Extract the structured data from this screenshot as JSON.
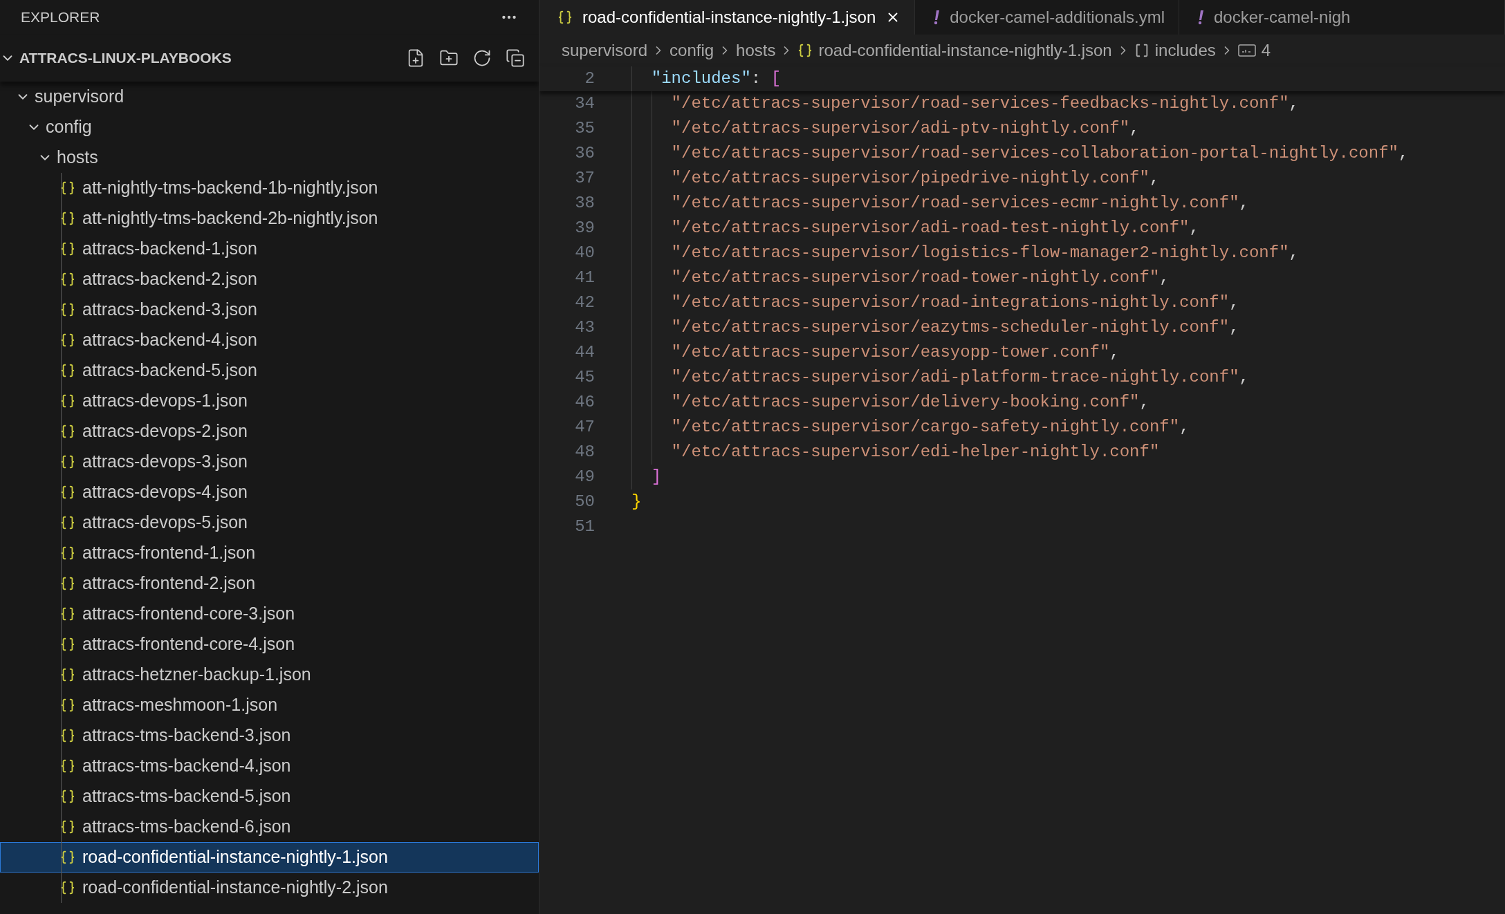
{
  "sidebar": {
    "title": "EXPLORER",
    "workspace": {
      "name": "ATTRACS-LINUX-PLAYBOOKS",
      "expanded": true
    },
    "tree": [
      {
        "name": "supervisord",
        "kind": "folder",
        "expanded": true,
        "children": [
          {
            "name": "config",
            "kind": "folder",
            "expanded": true,
            "children": [
              {
                "name": "hosts",
                "kind": "folder",
                "expanded": true,
                "children": [
                  {
                    "name": "att-nightly-tms-backend-1b-nightly.json",
                    "kind": "file",
                    "selected": false
                  },
                  {
                    "name": "att-nightly-tms-backend-2b-nightly.json",
                    "kind": "file",
                    "selected": false
                  },
                  {
                    "name": "attracs-backend-1.json",
                    "kind": "file",
                    "selected": false
                  },
                  {
                    "name": "attracs-backend-2.json",
                    "kind": "file",
                    "selected": false
                  },
                  {
                    "name": "attracs-backend-3.json",
                    "kind": "file",
                    "selected": false
                  },
                  {
                    "name": "attracs-backend-4.json",
                    "kind": "file",
                    "selected": false
                  },
                  {
                    "name": "attracs-backend-5.json",
                    "kind": "file",
                    "selected": false
                  },
                  {
                    "name": "attracs-devops-1.json",
                    "kind": "file",
                    "selected": false
                  },
                  {
                    "name": "attracs-devops-2.json",
                    "kind": "file",
                    "selected": false
                  },
                  {
                    "name": "attracs-devops-3.json",
                    "kind": "file",
                    "selected": false
                  },
                  {
                    "name": "attracs-devops-4.json",
                    "kind": "file",
                    "selected": false
                  },
                  {
                    "name": "attracs-devops-5.json",
                    "kind": "file",
                    "selected": false
                  },
                  {
                    "name": "attracs-frontend-1.json",
                    "kind": "file",
                    "selected": false
                  },
                  {
                    "name": "attracs-frontend-2.json",
                    "kind": "file",
                    "selected": false
                  },
                  {
                    "name": "attracs-frontend-core-3.json",
                    "kind": "file",
                    "selected": false
                  },
                  {
                    "name": "attracs-frontend-core-4.json",
                    "kind": "file",
                    "selected": false
                  },
                  {
                    "name": "attracs-hetzner-backup-1.json",
                    "kind": "file",
                    "selected": false
                  },
                  {
                    "name": "attracs-meshmoon-1.json",
                    "kind": "file",
                    "selected": false
                  },
                  {
                    "name": "attracs-tms-backend-3.json",
                    "kind": "file",
                    "selected": false
                  },
                  {
                    "name": "attracs-tms-backend-4.json",
                    "kind": "file",
                    "selected": false
                  },
                  {
                    "name": "attracs-tms-backend-5.json",
                    "kind": "file",
                    "selected": false
                  },
                  {
                    "name": "attracs-tms-backend-6.json",
                    "kind": "file",
                    "selected": false
                  },
                  {
                    "name": "road-confidential-instance-nightly-1.json",
                    "kind": "file",
                    "selected": true
                  },
                  {
                    "name": "road-confidential-instance-nightly-2.json",
                    "kind": "file",
                    "selected": false
                  }
                ]
              }
            ]
          }
        ]
      }
    ]
  },
  "tabs": [
    {
      "label": "road-confidential-instance-nightly-1.json",
      "kind": "json",
      "selected": true
    },
    {
      "label": "docker-camel-additionals.yml",
      "kind": "yaml",
      "selected": false
    },
    {
      "label": "docker-camel-nigh",
      "kind": "yaml",
      "selected": false
    }
  ],
  "breadcrumbs": [
    {
      "label": "supervisord",
      "kind": "folder"
    },
    {
      "label": "config",
      "kind": "folder"
    },
    {
      "label": "hosts",
      "kind": "folder"
    },
    {
      "label": "road-confidential-instance-nightly-1.json",
      "kind": "json"
    },
    {
      "label": "includes",
      "kind": "array"
    },
    {
      "label": "4",
      "kind": "string"
    }
  ],
  "sticky_line": {
    "number": "2",
    "tokens": [
      {
        "kind": "guide"
      },
      {
        "text": "\"includes\"",
        "kind": "key"
      },
      {
        "text": ": ",
        "kind": "punct"
      },
      {
        "text": "[",
        "kind": "bracket2"
      }
    ]
  },
  "code_lines": [
    {
      "number": "34",
      "tokens": [
        {
          "kind": "guide"
        },
        {
          "kind": "guide"
        },
        {
          "text": "\"/etc/attracs-supervisor/road-services-feedbacks-nightly.conf\"",
          "kind": "string"
        },
        {
          "text": ",",
          "kind": "punct"
        }
      ]
    },
    {
      "number": "35",
      "tokens": [
        {
          "kind": "guide"
        },
        {
          "kind": "guide"
        },
        {
          "text": "\"/etc/attracs-supervisor/adi-ptv-nightly.conf\"",
          "kind": "string"
        },
        {
          "text": ",",
          "kind": "punct"
        }
      ]
    },
    {
      "number": "36",
      "tokens": [
        {
          "kind": "guide"
        },
        {
          "kind": "guide"
        },
        {
          "text": "\"/etc/attracs-supervisor/road-services-collaboration-portal-nightly.conf\"",
          "kind": "string"
        },
        {
          "text": ",",
          "kind": "punct"
        }
      ]
    },
    {
      "number": "37",
      "tokens": [
        {
          "kind": "guide"
        },
        {
          "kind": "guide"
        },
        {
          "text": "\"/etc/attracs-supervisor/pipedrive-nightly.conf\"",
          "kind": "string"
        },
        {
          "text": ",",
          "kind": "punct"
        }
      ]
    },
    {
      "number": "38",
      "tokens": [
        {
          "kind": "guide"
        },
        {
          "kind": "guide"
        },
        {
          "text": "\"/etc/attracs-supervisor/road-services-ecmr-nightly.conf\"",
          "kind": "string"
        },
        {
          "text": ",",
          "kind": "punct"
        }
      ]
    },
    {
      "number": "39",
      "tokens": [
        {
          "kind": "guide"
        },
        {
          "kind": "guide"
        },
        {
          "text": "\"/etc/attracs-supervisor/adi-road-test-nightly.conf\"",
          "kind": "string"
        },
        {
          "text": ",",
          "kind": "punct"
        }
      ]
    },
    {
      "number": "40",
      "tokens": [
        {
          "kind": "guide"
        },
        {
          "kind": "guide"
        },
        {
          "text": "\"/etc/attracs-supervisor/logistics-flow-manager2-nightly.conf\"",
          "kind": "string"
        },
        {
          "text": ",",
          "kind": "punct"
        }
      ]
    },
    {
      "number": "41",
      "tokens": [
        {
          "kind": "guide"
        },
        {
          "kind": "guide"
        },
        {
          "text": "\"/etc/attracs-supervisor/road-tower-nightly.conf\"",
          "kind": "string"
        },
        {
          "text": ",",
          "kind": "punct"
        }
      ]
    },
    {
      "number": "42",
      "tokens": [
        {
          "kind": "guide"
        },
        {
          "kind": "guide"
        },
        {
          "text": "\"/etc/attracs-supervisor/road-integrations-nightly.conf\"",
          "kind": "string"
        },
        {
          "text": ",",
          "kind": "punct"
        }
      ]
    },
    {
      "number": "43",
      "tokens": [
        {
          "kind": "guide"
        },
        {
          "kind": "guide"
        },
        {
          "text": "\"/etc/attracs-supervisor/eazytms-scheduler-nightly.conf\"",
          "kind": "string"
        },
        {
          "text": ",",
          "kind": "punct"
        }
      ]
    },
    {
      "number": "44",
      "tokens": [
        {
          "kind": "guide"
        },
        {
          "kind": "guide"
        },
        {
          "text": "\"/etc/attracs-supervisor/easyopp-tower.conf\"",
          "kind": "string"
        },
        {
          "text": ",",
          "kind": "punct"
        }
      ]
    },
    {
      "number": "45",
      "tokens": [
        {
          "kind": "guide"
        },
        {
          "kind": "guide"
        },
        {
          "text": "\"/etc/attracs-supervisor/adi-platform-trace-nightly.conf\"",
          "kind": "string"
        },
        {
          "text": ",",
          "kind": "punct"
        }
      ]
    },
    {
      "number": "46",
      "tokens": [
        {
          "kind": "guide"
        },
        {
          "kind": "guide"
        },
        {
          "text": "\"/etc/attracs-supervisor/delivery-booking.conf\"",
          "kind": "string"
        },
        {
          "text": ",",
          "kind": "punct"
        }
      ]
    },
    {
      "number": "47",
      "tokens": [
        {
          "kind": "guide"
        },
        {
          "kind": "guide"
        },
        {
          "text": "\"/etc/attracs-supervisor/cargo-safety-nightly.conf\"",
          "kind": "string"
        },
        {
          "text": ",",
          "kind": "punct"
        }
      ]
    },
    {
      "number": "48",
      "tokens": [
        {
          "kind": "guide"
        },
        {
          "kind": "guide"
        },
        {
          "text": "\"/etc/attracs-supervisor/edi-helper-nightly.conf\"",
          "kind": "string"
        }
      ]
    },
    {
      "number": "49",
      "tokens": [
        {
          "kind": "guide"
        },
        {
          "text": "]",
          "kind": "bracket2"
        }
      ]
    },
    {
      "number": "50",
      "tokens": [
        {
          "text": "}",
          "kind": "bracket1"
        }
      ]
    },
    {
      "number": "51"
    }
  ]
}
